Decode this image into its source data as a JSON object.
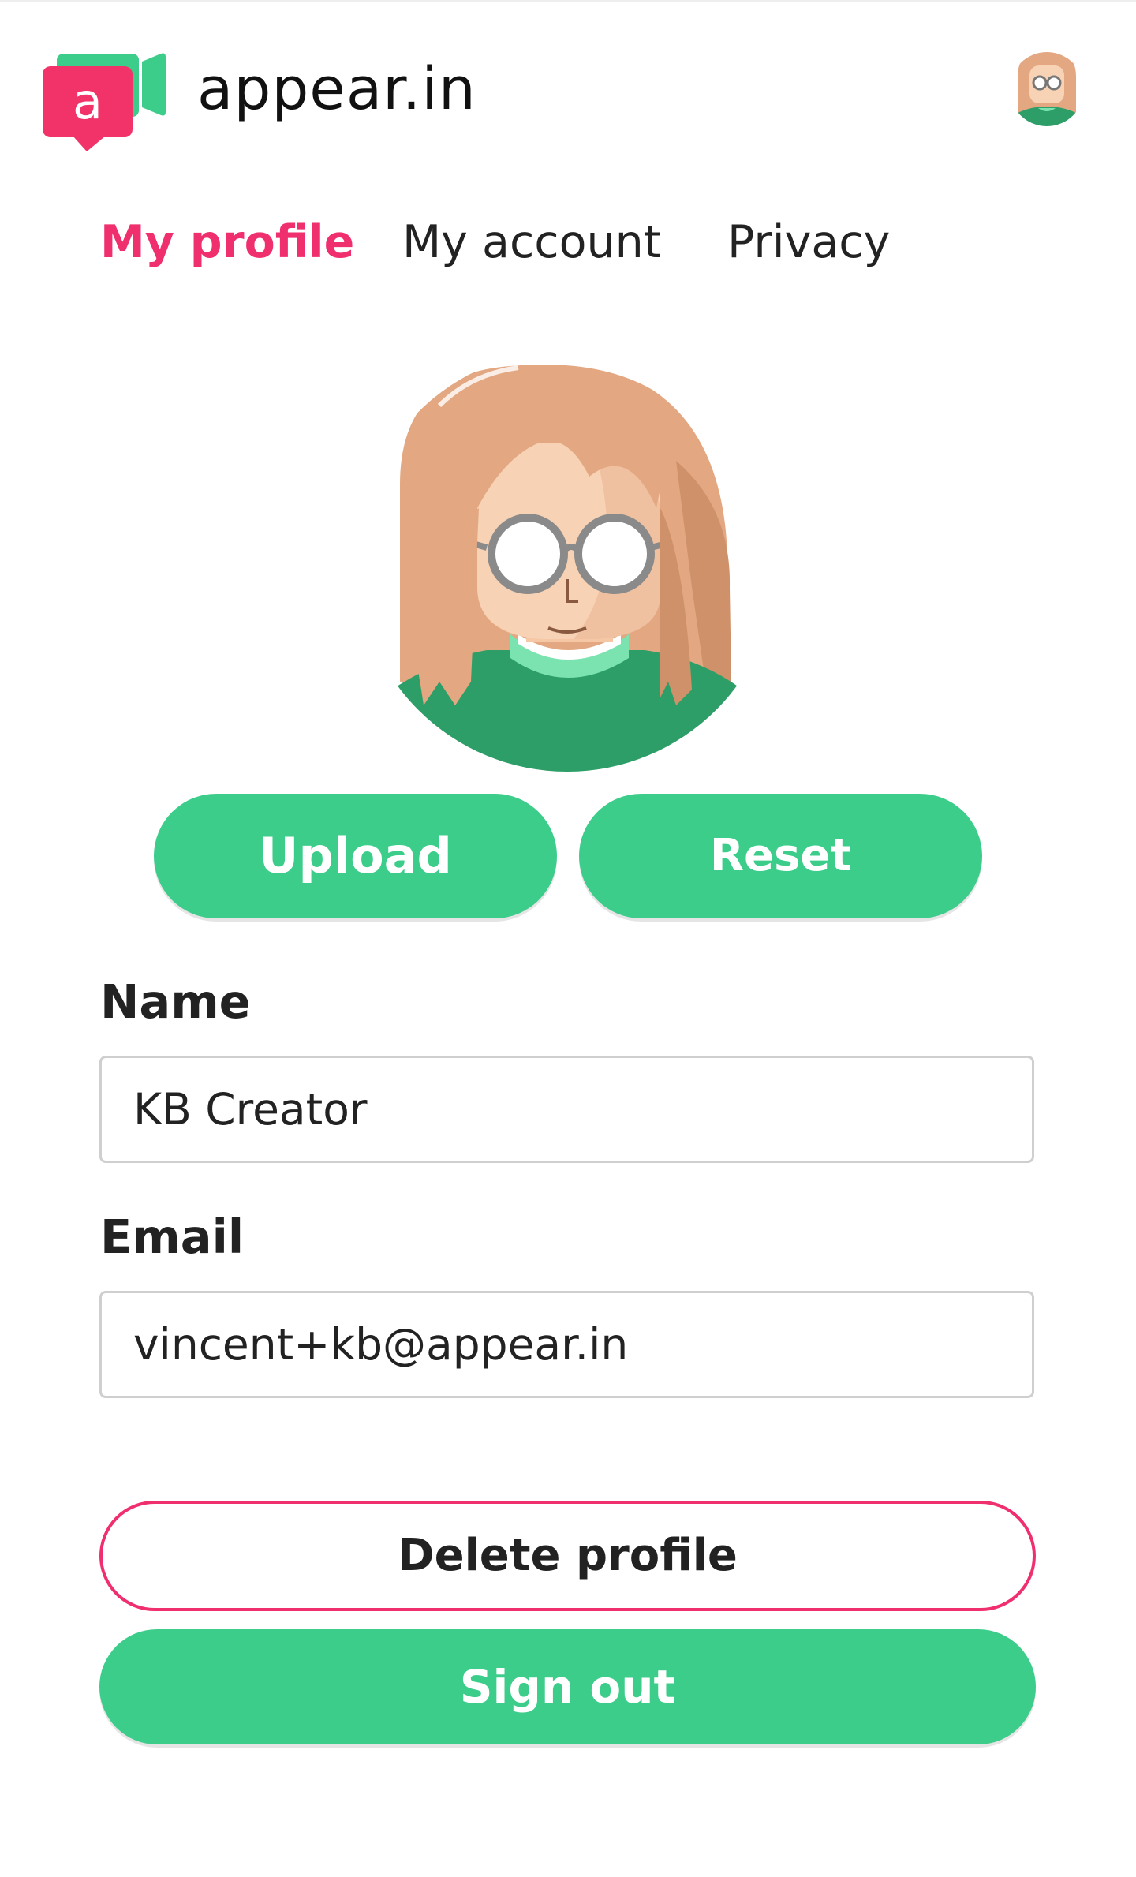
{
  "app": {
    "brand_name": "appear.in",
    "logo_letter": "a"
  },
  "tabs": [
    {
      "label": "My profile",
      "active": true
    },
    {
      "label": "My account",
      "active": false
    },
    {
      "label": "Privacy",
      "active": false
    }
  ],
  "avatar": {
    "upload_label": "Upload",
    "reset_label": "Reset"
  },
  "form": {
    "name_label": "Name",
    "name_value": "KB Creator",
    "email_label": "Email",
    "email_value": "vincent+kb@appear.in"
  },
  "actions": {
    "delete_label": "Delete profile",
    "signout_label": "Sign out"
  },
  "colors": {
    "accent_pink": "#ef2f6e",
    "accent_green": "#3ccd8a",
    "logo_green": "#3ccd8a",
    "logo_pink": "#f1336a"
  },
  "icons": {
    "logo": "appear-in-logo-icon",
    "header_avatar": "user-avatar-icon",
    "profile_avatar": "profile-avatar-illustration"
  }
}
